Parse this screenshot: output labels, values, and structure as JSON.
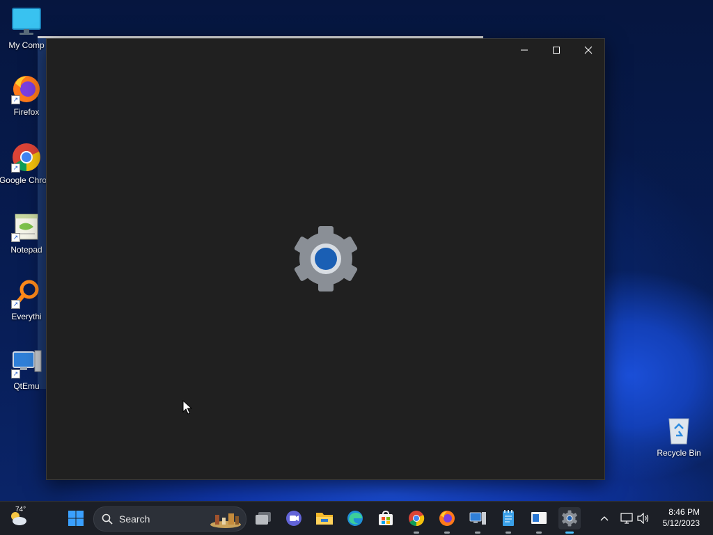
{
  "desktop": {
    "icons": [
      {
        "label": "My Comp",
        "icon": "monitor-icon"
      },
      {
        "label": "Firefox",
        "icon": "firefox-icon"
      },
      {
        "label": "Google Chrom",
        "icon": "chrome-icon"
      },
      {
        "label": "Notepad",
        "icon": "notepad-icon"
      },
      {
        "label": "Everythi",
        "icon": "everything-search-icon"
      },
      {
        "label": "QtEmu",
        "icon": "qtemu-icon"
      }
    ],
    "recycle_bin": {
      "label": "Recycle Bin",
      "icon": "recycle-bin-icon"
    }
  },
  "window": {
    "title": "",
    "content_icon": "settings-gear-icon",
    "colors": {
      "background": "#202020",
      "gear": "#8a8f96",
      "gear_center": "#1a5fb4"
    }
  },
  "taskbar": {
    "weather": {
      "temperature": "74°",
      "icon": "partly-cloudy-icon"
    },
    "search": {
      "placeholder": "Search"
    },
    "apps": [
      {
        "name": "task-view",
        "icon": "task-view-icon"
      },
      {
        "name": "teams-meet",
        "icon": "video-call-icon"
      },
      {
        "name": "file-explorer",
        "icon": "folder-icon"
      },
      {
        "name": "edge",
        "icon": "edge-icon"
      },
      {
        "name": "store",
        "icon": "store-icon"
      },
      {
        "name": "chrome",
        "icon": "chrome-icon"
      },
      {
        "name": "firefox",
        "icon": "firefox-icon"
      },
      {
        "name": "remote-desktop",
        "icon": "computer-icon"
      },
      {
        "name": "notepad",
        "icon": "notepad-icon"
      },
      {
        "name": "qtemu",
        "icon": "qtemu-icon"
      },
      {
        "name": "settings",
        "icon": "gear-icon"
      }
    ],
    "clock": {
      "time": "8:46 PM",
      "date": "5/12/2023"
    }
  }
}
